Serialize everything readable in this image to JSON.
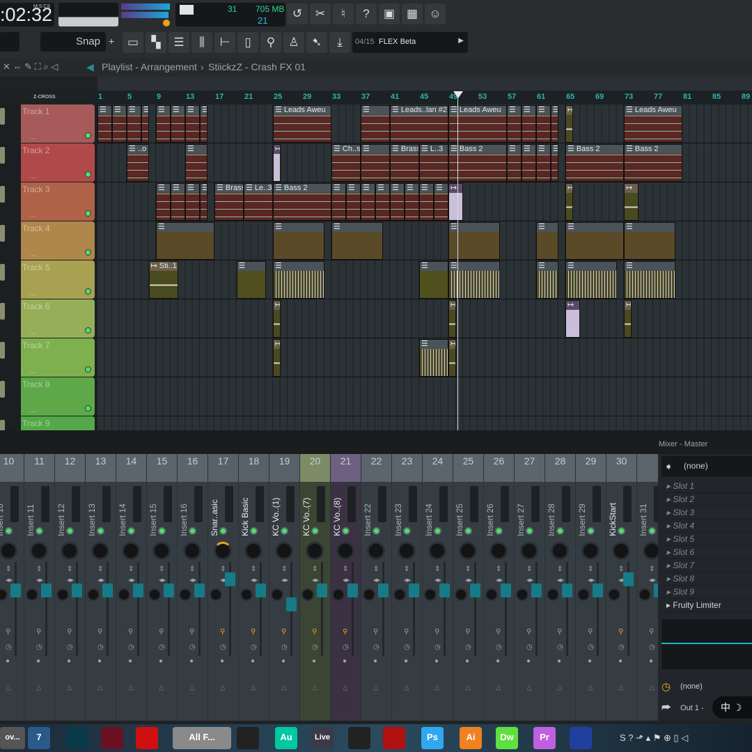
{
  "toolbar": {
    "time": ":02:32",
    "time_format": "M:S:CS",
    "cpu": "31",
    "memory": "705 MB",
    "polyphony": "21",
    "icons": [
      "undo-icon",
      "cut-icon",
      "microphone-icon",
      "help-icon",
      "save-icon",
      "save-audio-icon",
      "chat-icon"
    ],
    "snap": "Snap",
    "plus": "+",
    "tools": [
      "playlist-icon",
      "piano-roll-icon",
      "channel-rack-icon",
      "mixer-icon",
      "browser-icon",
      "files-icon",
      "plugin-icon",
      "performance-icon",
      "hint-icon",
      "download-icon"
    ],
    "news_index": "04/15",
    "news_text": "FLEX Beta"
  },
  "breadcrumb": {
    "window": "Playlist - Arrangement",
    "sep": "›",
    "pattern": "StiickzZ - Crash FX 01"
  },
  "ruler": {
    "zcross": "Z-CROSS",
    "bars": [
      "1",
      "5",
      "9",
      "13",
      "17",
      "21",
      "25",
      "29",
      "33",
      "37",
      "41",
      "45",
      "49",
      "53",
      "57",
      "61",
      "65",
      "69",
      "73",
      "77",
      "81",
      "85",
      "89"
    ],
    "playhead_bar": 50
  },
  "tracks": [
    {
      "name": "Track 1",
      "color": "#a65a5a",
      "dots": "...",
      "clips": [
        [
          1,
          2,
          "",
          "p"
        ],
        [
          3,
          2,
          "",
          "p"
        ],
        [
          5,
          2,
          "",
          "p"
        ],
        [
          7,
          1,
          "",
          "p"
        ],
        [
          9,
          2,
          "",
          "p"
        ],
        [
          11,
          2,
          "",
          "p"
        ],
        [
          13,
          2,
          "",
          "p"
        ],
        [
          15,
          1,
          "",
          "p"
        ],
        [
          25,
          8,
          "Leads Aweu",
          "p"
        ],
        [
          37,
          4,
          "",
          "p"
        ],
        [
          41,
          8,
          "Leads..lan #2",
          "p"
        ],
        [
          49,
          8,
          "Leads Aweu",
          "p"
        ],
        [
          57,
          2,
          "",
          "p"
        ],
        [
          59,
          2,
          "",
          "p"
        ],
        [
          61,
          2,
          "",
          "p"
        ],
        [
          63,
          1,
          "",
          "p"
        ],
        [
          65,
          1,
          "",
          "a"
        ],
        [
          73,
          8,
          "Leads Aweu",
          "p"
        ]
      ]
    },
    {
      "name": "Track 2",
      "color": "#b04a4a",
      "dots": "...",
      "clips": [
        [
          5,
          3,
          "..o",
          "p"
        ],
        [
          13,
          3,
          "",
          "p"
        ],
        [
          25,
          1,
          "",
          "l"
        ],
        [
          33,
          4,
          "Ch..s",
          "p"
        ],
        [
          37,
          4,
          "",
          "p"
        ],
        [
          41,
          4,
          "Brass",
          "p"
        ],
        [
          45,
          4,
          "L..3",
          "p"
        ],
        [
          49,
          8,
          "Bass 2",
          "p"
        ],
        [
          57,
          2,
          "",
          "p"
        ],
        [
          59,
          2,
          "",
          "p"
        ],
        [
          61,
          2,
          "",
          "p"
        ],
        [
          63,
          1,
          "",
          "p"
        ],
        [
          65,
          8,
          "Bass 2",
          "p"
        ],
        [
          73,
          8,
          "Bass 2",
          "p"
        ]
      ]
    },
    {
      "name": "Track 3",
      "color": "#b06248",
      "dots": "...",
      "clips": [
        [
          9,
          2,
          "",
          "p"
        ],
        [
          11,
          2,
          "",
          "p"
        ],
        [
          13,
          2,
          "",
          "p"
        ],
        [
          15,
          1,
          "",
          "p"
        ],
        [
          17,
          4,
          "Brass",
          "p"
        ],
        [
          21,
          4,
          "Le..3",
          "p"
        ],
        [
          25,
          8,
          "Bass 2",
          "p"
        ],
        [
          33,
          2,
          "",
          "p"
        ],
        [
          35,
          2,
          "",
          "p"
        ],
        [
          37,
          2,
          "",
          "p"
        ],
        [
          39,
          2,
          "",
          "p"
        ],
        [
          41,
          2,
          "",
          "p"
        ],
        [
          43,
          2,
          "",
          "p"
        ],
        [
          45,
          2,
          "",
          "p"
        ],
        [
          47,
          2,
          "",
          "p"
        ],
        [
          49,
          2,
          "",
          "l"
        ],
        [
          65,
          1,
          "",
          "a"
        ],
        [
          73,
          2,
          "",
          "a"
        ]
      ]
    },
    {
      "name": "Track 4",
      "color": "#b0874a",
      "dots": "...",
      "clips": [
        [
          9,
          8,
          "",
          "b"
        ],
        [
          25,
          7,
          "",
          "b"
        ],
        [
          33,
          7,
          "",
          "b"
        ],
        [
          49,
          7,
          "",
          "b"
        ],
        [
          61,
          3,
          "",
          "b"
        ],
        [
          65,
          8,
          "",
          "b"
        ],
        [
          73,
          7,
          "",
          "b"
        ]
      ]
    },
    {
      "name": "Track 5",
      "color": "#a9a152",
      "dots": "...",
      "clips": [
        [
          8,
          4,
          "Sti..1",
          "a"
        ],
        [
          20,
          4,
          "",
          "o"
        ],
        [
          25,
          7,
          "",
          "w"
        ],
        [
          45,
          4,
          "",
          "o"
        ],
        [
          49,
          7,
          "",
          "w"
        ],
        [
          61,
          3,
          "",
          "w"
        ],
        [
          65,
          7,
          "",
          "w"
        ],
        [
          73,
          7,
          "",
          "w"
        ]
      ]
    },
    {
      "name": "Track 6",
      "color": "#97ae58",
      "dots": "...",
      "clips": [
        [
          25,
          1,
          "",
          "a"
        ],
        [
          49,
          1,
          "",
          "a"
        ],
        [
          65,
          2,
          "",
          "l"
        ],
        [
          73,
          1,
          "",
          "a"
        ]
      ]
    },
    {
      "name": "Track 7",
      "color": "#7fb04f",
      "dots": "...",
      "clips": [
        [
          25,
          1,
          "",
          "a"
        ],
        [
          45,
          4,
          "",
          "w"
        ],
        [
          49,
          1,
          "",
          "a"
        ]
      ]
    },
    {
      "name": "Track 8",
      "color": "#5fa84a",
      "dots": "...",
      "clips": []
    },
    {
      "name": "Track 9",
      "color": "#55a849",
      "dots": "...",
      "clips": []
    }
  ],
  "mixer": {
    "title": "Mixer - Master",
    "channels": [
      {
        "num": "10",
        "name": "Insert 10"
      },
      {
        "num": "11",
        "name": "Insert 11"
      },
      {
        "num": "12",
        "name": "Insert 12"
      },
      {
        "num": "13",
        "name": "Insert 13"
      },
      {
        "num": "14",
        "name": "Insert 14"
      },
      {
        "num": "15",
        "name": "Insert 15"
      },
      {
        "num": "16",
        "name": "Insert 16"
      },
      {
        "num": "17",
        "name": "Snar..asic"
      },
      {
        "num": "18",
        "name": "Kick Basic"
      },
      {
        "num": "19",
        "name": "KC Vo..(1)"
      },
      {
        "num": "20",
        "name": "KC Vo..(7)",
        "bg": "#3b4534",
        "hdr": "#7c8a66"
      },
      {
        "num": "21",
        "name": "KC Vo..(8)",
        "bg": "#3a3242",
        "hdr": "#6e6080"
      },
      {
        "num": "22",
        "name": "Insert 22"
      },
      {
        "num": "23",
        "name": "Insert 23"
      },
      {
        "num": "24",
        "name": "Insert 24"
      },
      {
        "num": "25",
        "name": "Insert 25"
      },
      {
        "num": "26",
        "name": "Insert 26"
      },
      {
        "num": "27",
        "name": "Insert 27"
      },
      {
        "num": "28",
        "name": "Insert 28"
      },
      {
        "num": "29",
        "name": "Insert 29"
      },
      {
        "num": "30",
        "name": "KickStart"
      },
      {
        "num": "",
        "name": "Insert 31"
      }
    ],
    "input": "(none)",
    "slots": [
      "Slot 1",
      "Slot 2",
      "Slot 3",
      "Slot 4",
      "Slot 5",
      "Slot 6",
      "Slot 7",
      "Slot 8",
      "Slot 9"
    ],
    "effect": "Fruity Limiter",
    "sidechain": "(none)",
    "output": "Out 1 -"
  },
  "taskbar": {
    "items": [
      {
        "label": "ov...",
        "color": "#555"
      },
      {
        "label": "7",
        "color": "#2a5a8a"
      },
      {
        "label": "",
        "color": "#0a3a4a"
      },
      {
        "label": "",
        "color": "#6a1020"
      },
      {
        "label": "",
        "color": "#d01010"
      },
      {
        "label": "All F...",
        "color": "#7a6a50"
      },
      {
        "label": "",
        "color": "#222"
      },
      {
        "label": "Au",
        "color": "#00c8a0"
      },
      {
        "label": "Live",
        "color": "#3a3a48"
      },
      {
        "label": "",
        "color": "#222"
      },
      {
        "label": "",
        "color": "#b01010"
      },
      {
        "label": "Ps",
        "color": "#30a8f0"
      },
      {
        "label": "Ai",
        "color": "#f08020"
      },
      {
        "label": "Dw",
        "color": "#60e040"
      },
      {
        "label": "Pr",
        "color": "#c060e0"
      },
      {
        "label": "",
        "color": "#2040a0"
      }
    ],
    "tray": [
      "中",
      "☽"
    ]
  }
}
